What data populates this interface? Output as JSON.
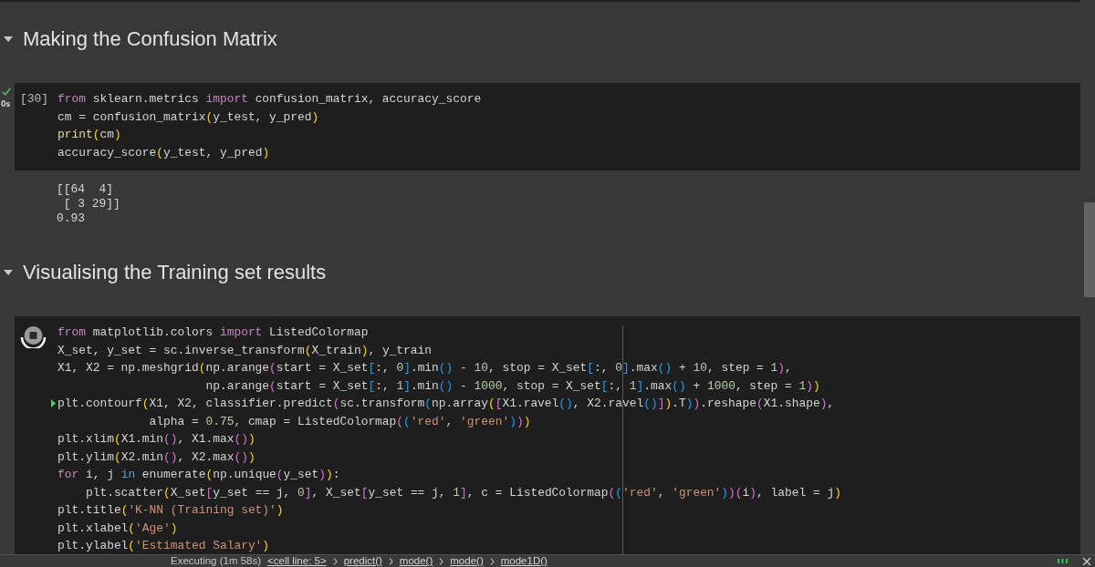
{
  "sections": [
    {
      "title": "Making the Confusion Matrix",
      "expanded": true,
      "cells": [
        {
          "running": false,
          "execution_count": "[30]",
          "time": "0s",
          "focused": false,
          "lines": [
            {
              "current": false,
              "tokens": [
                {
                  "kind": "keyword",
                  "text": "from"
                },
                {
                  "kind": "plain",
                  "text": " sklearn.metrics "
                },
                {
                  "kind": "keyword",
                  "text": "import"
                },
                {
                  "kind": "plain",
                  "text": " confusion_matrix, accuracy_score"
                }
              ]
            },
            {
              "current": false,
              "tokens": [
                {
                  "kind": "plain",
                  "text": "cm = confusion_matrix"
                },
                {
                  "kind": "bracket1",
                  "text": "("
                },
                {
                  "kind": "plain",
                  "text": "y_test, y_pred"
                },
                {
                  "kind": "bracket1",
                  "text": ")"
                }
              ]
            },
            {
              "current": false,
              "tokens": [
                {
                  "kind": "builtin",
                  "text": "print"
                },
                {
                  "kind": "bracket1",
                  "text": "("
                },
                {
                  "kind": "plain",
                  "text": "cm"
                },
                {
                  "kind": "bracket1",
                  "text": ")"
                }
              ]
            },
            {
              "current": false,
              "tokens": [
                {
                  "kind": "plain",
                  "text": "accuracy_score"
                },
                {
                  "kind": "bracket1",
                  "text": "("
                },
                {
                  "kind": "plain",
                  "text": "y_test, y_pred"
                },
                {
                  "kind": "bracket1",
                  "text": ")"
                }
              ]
            }
          ],
          "output": [
            "[[64  4]",
            " [ 3 29]]",
            "0.93"
          ]
        }
      ]
    },
    {
      "title": "Visualising the Training set results",
      "expanded": true,
      "cells": [
        {
          "running": true,
          "focused": true,
          "lines": [
            {
              "current": false,
              "tokens": [
                {
                  "kind": "keyword",
                  "text": "from"
                },
                {
                  "kind": "plain",
                  "text": " matplotlib.colors "
                },
                {
                  "kind": "keyword",
                  "text": "import"
                },
                {
                  "kind": "plain",
                  "text": " ListedColormap"
                }
              ]
            },
            {
              "current": false,
              "tokens": [
                {
                  "kind": "plain",
                  "text": "X_set, y_set = sc.inverse_transform"
                },
                {
                  "kind": "bracket1",
                  "text": "("
                },
                {
                  "kind": "plain",
                  "text": "X_train"
                },
                {
                  "kind": "bracket1",
                  "text": ")"
                },
                {
                  "kind": "plain",
                  "text": ", y_train"
                }
              ]
            },
            {
              "current": false,
              "tokens": [
                {
                  "kind": "plain",
                  "text": "X1, X2 = np.meshgrid"
                },
                {
                  "kind": "bracket1",
                  "text": "("
                },
                {
                  "kind": "plain",
                  "text": "np.arange"
                },
                {
                  "kind": "bracket2",
                  "text": "("
                },
                {
                  "kind": "plain",
                  "text": "start = X_set"
                },
                {
                  "kind": "bracket3",
                  "text": "["
                },
                {
                  "kind": "plain",
                  "text": ":, "
                },
                {
                  "kind": "number",
                  "text": "0"
                },
                {
                  "kind": "bracket3",
                  "text": "]"
                },
                {
                  "kind": "plain",
                  "text": ".min"
                },
                {
                  "kind": "bracket3",
                  "text": "()"
                },
                {
                  "kind": "plain",
                  "text": " - "
                },
                {
                  "kind": "number",
                  "text": "10"
                },
                {
                  "kind": "plain",
                  "text": ", stop = X_set"
                },
                {
                  "kind": "bracket3",
                  "text": "["
                },
                {
                  "kind": "plain",
                  "text": ":, "
                },
                {
                  "kind": "number",
                  "text": "0"
                },
                {
                  "kind": "bracket3",
                  "text": "]"
                },
                {
                  "kind": "plain",
                  "text": ".max"
                },
                {
                  "kind": "bracket3",
                  "text": "()"
                },
                {
                  "kind": "plain",
                  "text": " + "
                },
                {
                  "kind": "number",
                  "text": "10"
                },
                {
                  "kind": "plain",
                  "text": ", step = "
                },
                {
                  "kind": "number",
                  "text": "1"
                },
                {
                  "kind": "bracket2",
                  "text": ")"
                },
                {
                  "kind": "plain",
                  "text": ","
                }
              ]
            },
            {
              "current": false,
              "tokens": [
                {
                  "kind": "plain",
                  "text": "                     np.arange"
                },
                {
                  "kind": "bracket2",
                  "text": "("
                },
                {
                  "kind": "plain",
                  "text": "start = X_set"
                },
                {
                  "kind": "bracket3",
                  "text": "["
                },
                {
                  "kind": "plain",
                  "text": ":, "
                },
                {
                  "kind": "number",
                  "text": "1"
                },
                {
                  "kind": "bracket3",
                  "text": "]"
                },
                {
                  "kind": "plain",
                  "text": ".min"
                },
                {
                  "kind": "bracket3",
                  "text": "()"
                },
                {
                  "kind": "plain",
                  "text": " - "
                },
                {
                  "kind": "number",
                  "text": "1000"
                },
                {
                  "kind": "plain",
                  "text": ", stop = X_set"
                },
                {
                  "kind": "bracket3",
                  "text": "["
                },
                {
                  "kind": "plain",
                  "text": ":, "
                },
                {
                  "kind": "number",
                  "text": "1"
                },
                {
                  "kind": "bracket3",
                  "text": "]"
                },
                {
                  "kind": "plain",
                  "text": ".max"
                },
                {
                  "kind": "bracket3",
                  "text": "()"
                },
                {
                  "kind": "plain",
                  "text": " + "
                },
                {
                  "kind": "number",
                  "text": "1000"
                },
                {
                  "kind": "plain",
                  "text": ", step = "
                },
                {
                  "kind": "number",
                  "text": "1"
                },
                {
                  "kind": "bracket2",
                  "text": ")"
                },
                {
                  "kind": "bracket1",
                  "text": ")"
                }
              ]
            },
            {
              "current": true,
              "tokens": [
                {
                  "kind": "plain",
                  "text": "plt.contourf"
                },
                {
                  "kind": "bracket1",
                  "text": "("
                },
                {
                  "kind": "plain",
                  "text": "X1, X2, classifier.predict"
                },
                {
                  "kind": "bracket2",
                  "text": "("
                },
                {
                  "kind": "plain",
                  "text": "sc.transform"
                },
                {
                  "kind": "bracket3",
                  "text": "("
                },
                {
                  "kind": "plain",
                  "text": "np.array"
                },
                {
                  "kind": "bracket1",
                  "text": "("
                },
                {
                  "kind": "bracket2",
                  "text": "["
                },
                {
                  "kind": "plain",
                  "text": "X1.ravel"
                },
                {
                  "kind": "bracket3",
                  "text": "()"
                },
                {
                  "kind": "plain",
                  "text": ", X2.ravel"
                },
                {
                  "kind": "bracket3",
                  "text": "()"
                },
                {
                  "kind": "bracket2",
                  "text": "]"
                },
                {
                  "kind": "bracket1",
                  "text": ")"
                },
                {
                  "kind": "plain",
                  "text": ".T"
                },
                {
                  "kind": "bracket3",
                  "text": ")"
                },
                {
                  "kind": "bracket2",
                  "text": ")"
                },
                {
                  "kind": "plain",
                  "text": ".reshape"
                },
                {
                  "kind": "bracket2",
                  "text": "("
                },
                {
                  "kind": "plain",
                  "text": "X1.shape"
                },
                {
                  "kind": "bracket2",
                  "text": ")"
                },
                {
                  "kind": "plain",
                  "text": ","
                }
              ]
            },
            {
              "current": false,
              "tokens": [
                {
                  "kind": "plain",
                  "text": "             alpha = "
                },
                {
                  "kind": "number",
                  "text": "0.75"
                },
                {
                  "kind": "plain",
                  "text": ", cmap = ListedColormap"
                },
                {
                  "kind": "bracket2",
                  "text": "("
                },
                {
                  "kind": "bracket3",
                  "text": "("
                },
                {
                  "kind": "string",
                  "text": "'red'"
                },
                {
                  "kind": "plain",
                  "text": ", "
                },
                {
                  "kind": "string",
                  "text": "'green'"
                },
                {
                  "kind": "bracket3",
                  "text": ")"
                },
                {
                  "kind": "bracket2",
                  "text": ")"
                },
                {
                  "kind": "bracket1",
                  "text": ")"
                }
              ]
            },
            {
              "current": false,
              "tokens": [
                {
                  "kind": "plain",
                  "text": "plt.xlim"
                },
                {
                  "kind": "bracket1",
                  "text": "("
                },
                {
                  "kind": "plain",
                  "text": "X1.min"
                },
                {
                  "kind": "bracket2",
                  "text": "()"
                },
                {
                  "kind": "plain",
                  "text": ", X1.max"
                },
                {
                  "kind": "bracket2",
                  "text": "()"
                },
                {
                  "kind": "bracket1",
                  "text": ")"
                }
              ]
            },
            {
              "current": false,
              "tokens": [
                {
                  "kind": "plain",
                  "text": "plt.ylim"
                },
                {
                  "kind": "bracket1",
                  "text": "("
                },
                {
                  "kind": "plain",
                  "text": "X2.min"
                },
                {
                  "kind": "bracket2",
                  "text": "()"
                },
                {
                  "kind": "plain",
                  "text": ", X2.max"
                },
                {
                  "kind": "bracket2",
                  "text": "()"
                },
                {
                  "kind": "bracket1",
                  "text": ")"
                }
              ]
            },
            {
              "current": false,
              "tokens": [
                {
                  "kind": "keyword",
                  "text": "for"
                },
                {
                  "kind": "plain",
                  "text": " i, j "
                },
                {
                  "kind": "operator",
                  "text": "in"
                },
                {
                  "kind": "plain",
                  "text": " enumerate"
                },
                {
                  "kind": "bracket1",
                  "text": "("
                },
                {
                  "kind": "plain",
                  "text": "np.unique"
                },
                {
                  "kind": "bracket2",
                  "text": "("
                },
                {
                  "kind": "plain",
                  "text": "y_set"
                },
                {
                  "kind": "bracket2",
                  "text": ")"
                },
                {
                  "kind": "bracket1",
                  "text": ")"
                },
                {
                  "kind": "plain",
                  "text": ":"
                }
              ]
            },
            {
              "current": false,
              "tokens": [
                {
                  "kind": "plain",
                  "text": "    plt.scatter"
                },
                {
                  "kind": "bracket1",
                  "text": "("
                },
                {
                  "kind": "plain",
                  "text": "X_set"
                },
                {
                  "kind": "bracket2",
                  "text": "["
                },
                {
                  "kind": "plain",
                  "text": "y_set == j, "
                },
                {
                  "kind": "number",
                  "text": "0"
                },
                {
                  "kind": "bracket2",
                  "text": "]"
                },
                {
                  "kind": "plain",
                  "text": ", X_set"
                },
                {
                  "kind": "bracket2",
                  "text": "["
                },
                {
                  "kind": "plain",
                  "text": "y_set == j, "
                },
                {
                  "kind": "number",
                  "text": "1"
                },
                {
                  "kind": "bracket2",
                  "text": "]"
                },
                {
                  "kind": "plain",
                  "text": ", c = ListedColormap"
                },
                {
                  "kind": "bracket2",
                  "text": "("
                },
                {
                  "kind": "bracket3",
                  "text": "("
                },
                {
                  "kind": "string",
                  "text": "'red'"
                },
                {
                  "kind": "plain",
                  "text": ", "
                },
                {
                  "kind": "string",
                  "text": "'green'"
                },
                {
                  "kind": "bracket3",
                  "text": ")"
                },
                {
                  "kind": "bracket2",
                  "text": ")"
                },
                {
                  "kind": "bracket2",
                  "text": "("
                },
                {
                  "kind": "plain",
                  "text": "i"
                },
                {
                  "kind": "bracket2",
                  "text": ")"
                },
                {
                  "kind": "plain",
                  "text": ", label = j"
                },
                {
                  "kind": "bracket1",
                  "text": ")"
                }
              ]
            },
            {
              "current": false,
              "tokens": [
                {
                  "kind": "plain",
                  "text": "plt.title"
                },
                {
                  "kind": "bracket1",
                  "text": "("
                },
                {
                  "kind": "string",
                  "text": "'K-NN (Training set)'"
                },
                {
                  "kind": "bracket1",
                  "text": ")"
                }
              ]
            },
            {
              "current": false,
              "tokens": [
                {
                  "kind": "plain",
                  "text": "plt.xlabel"
                },
                {
                  "kind": "bracket1",
                  "text": "("
                },
                {
                  "kind": "string",
                  "text": "'Age'"
                },
                {
                  "kind": "bracket1",
                  "text": ")"
                }
              ]
            },
            {
              "current": false,
              "tokens": [
                {
                  "kind": "plain",
                  "text": "plt.ylabel"
                },
                {
                  "kind": "bracket1",
                  "text": "("
                },
                {
                  "kind": "string",
                  "text": "'Estimated Salary'"
                },
                {
                  "kind": "bracket1",
                  "text": ")"
                }
              ]
            }
          ]
        }
      ]
    }
  ],
  "status_bar": {
    "status": "Executing (1m 58s)",
    "call_stack": [
      "<cell line: 5>",
      "predict()",
      "mode()",
      "mode()",
      "mode1D()"
    ]
  }
}
